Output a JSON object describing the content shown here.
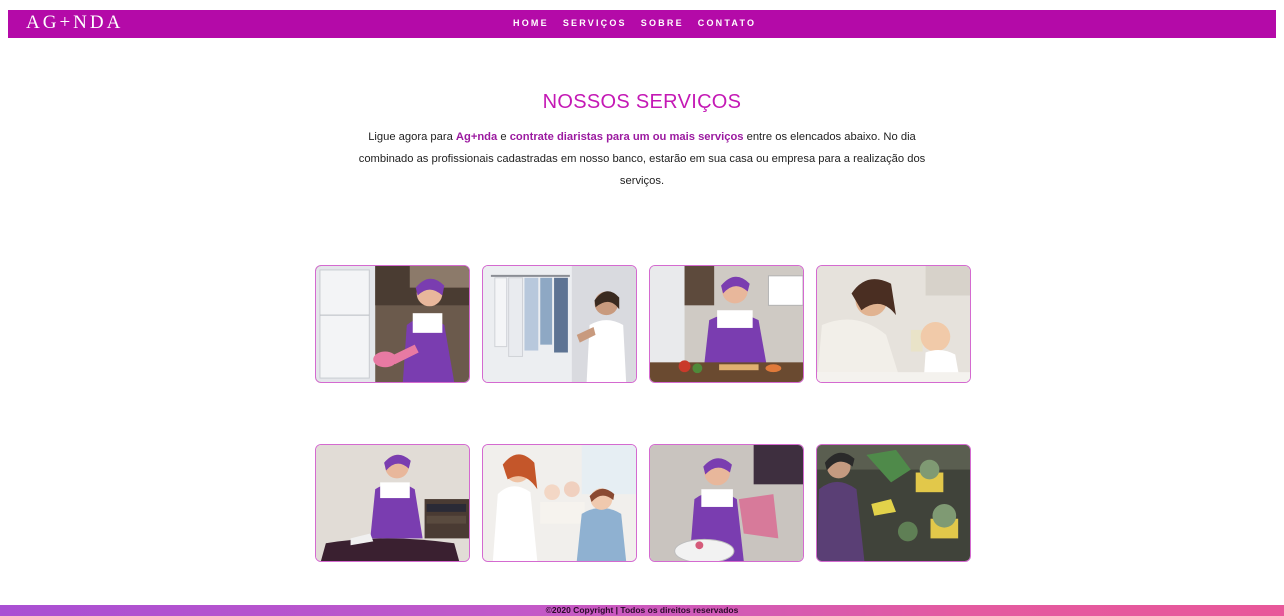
{
  "header": {
    "brand": "AG+NDA",
    "nav": [
      {
        "label": "HOME"
      },
      {
        "label": "SERVIÇOS"
      },
      {
        "label": "SOBRE"
      },
      {
        "label": "CONTATO"
      }
    ]
  },
  "services": {
    "title": "NOSSOS SERVIÇOS",
    "intro": {
      "part1": "Ligue agora para ",
      "brand": "Ag+nda",
      "part2": " e ",
      "highlight": "contrate diaristas para um ou mais serviços",
      "part3": " entre os elencados abaixo. No dia combinado as profissionais cadastradas em nosso banco, estarão em sua casa ou empresa para a realização dos serviços."
    },
    "cards": [
      {
        "icon": "cleaning-photo"
      },
      {
        "icon": "wardrobe-organizing-photo"
      },
      {
        "icon": "cooking-photo"
      },
      {
        "icon": "babysitting-photo"
      },
      {
        "icon": "ironing-photo"
      },
      {
        "icon": "elderly-care-photo"
      },
      {
        "icon": "laundry-photo"
      },
      {
        "icon": "gardening-photo"
      }
    ]
  },
  "footer": {
    "text": "©2020 Copyright | Todos os direitos reservados"
  },
  "colors": {
    "brand": "#b40aa8",
    "title": "#c419b5",
    "highlight": "#9b1aa0",
    "uniform": "#7a3db0"
  }
}
